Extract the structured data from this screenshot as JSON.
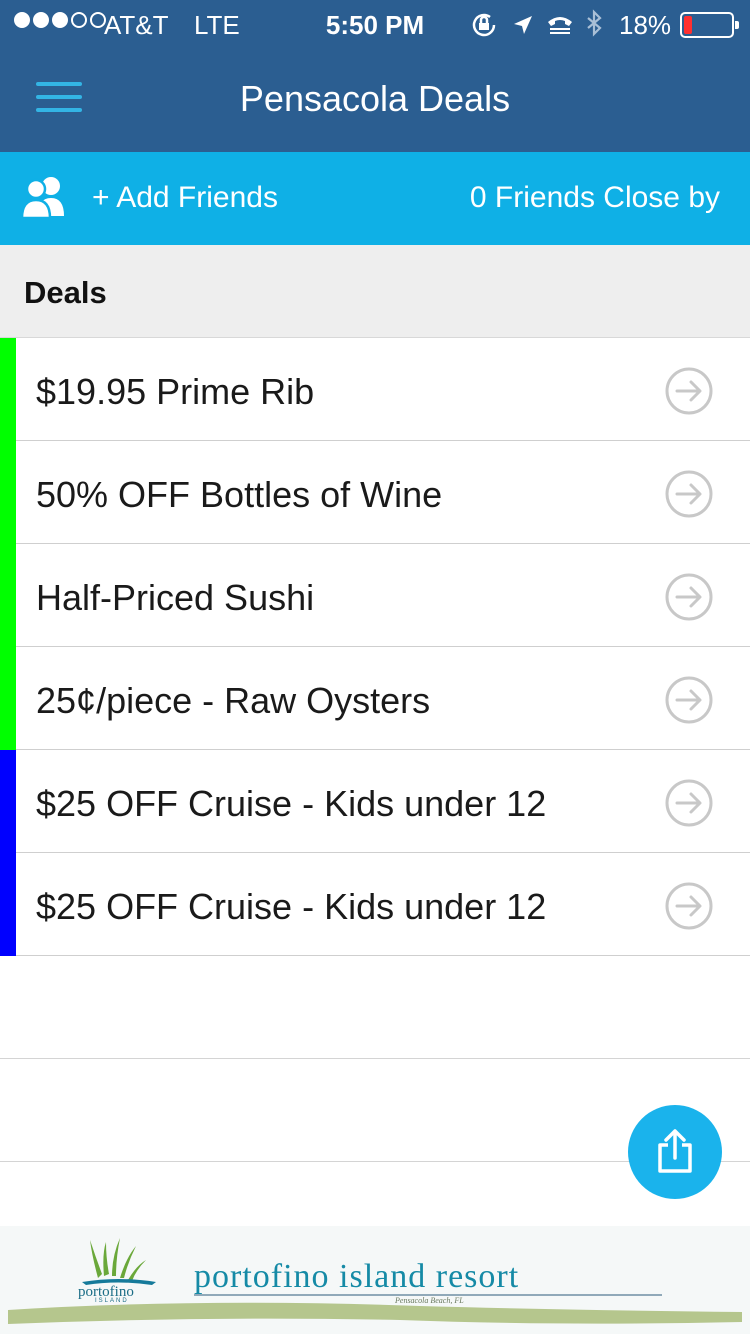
{
  "status_bar": {
    "carrier": "AT&T",
    "network": "LTE",
    "time": "5:50 PM",
    "battery": "18%",
    "battery_level": 0.18,
    "icons": [
      "rotation-lock-icon",
      "location-arrow-icon",
      "tty-icon",
      "bluetooth-icon"
    ]
  },
  "nav": {
    "title": "Pensacola Deals",
    "menu_icon": "hamburger-menu-icon"
  },
  "friends_bar": {
    "add_label": "+ Add Friends",
    "close_by": "0 Friends Close by",
    "icon": "friends-icon"
  },
  "section": {
    "title": "Deals"
  },
  "deals": [
    {
      "label": "$19.95 Prime Rib",
      "color": "#00ff00"
    },
    {
      "label": "50% OFF Bottles of Wine",
      "color": "#00ff00"
    },
    {
      "label": "Half-Priced Sushi",
      "color": "#00ff00"
    },
    {
      "label": "25¢/piece - Raw Oysters",
      "color": "#00ff00"
    },
    {
      "label": "$25 OFF Cruise - Kids under 12",
      "color": "#0000ff"
    },
    {
      "label": "$25 OFF Cruise - Kids under 12",
      "color": "#0000ff"
    }
  ],
  "fab": {
    "icon": "share-icon"
  },
  "ad": {
    "logo_name": "portofino",
    "logo_sub": "ISLAND",
    "headline": "portofino island resort",
    "sub": "Pensacola Beach, FL"
  },
  "colors": {
    "nav_bg": "#2b5e91",
    "friends_bg": "#0fb0e6",
    "fab_bg": "#1ab3ec"
  }
}
